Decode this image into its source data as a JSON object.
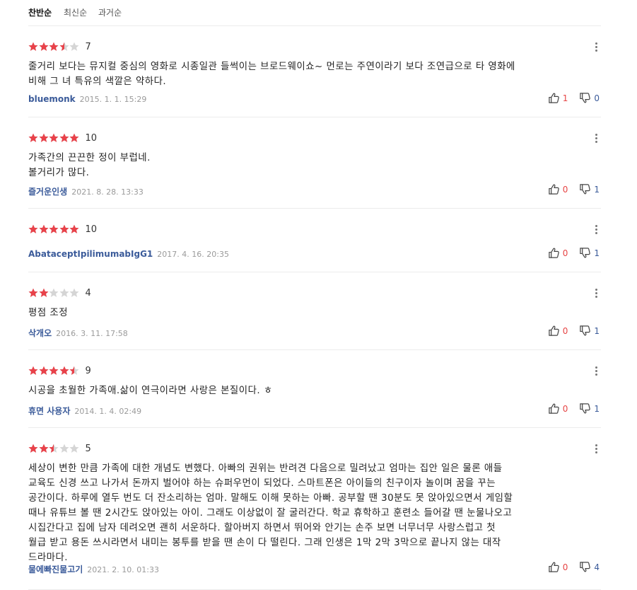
{
  "sort_tabs": [
    "찬반순",
    "최신순",
    "과거순"
  ],
  "active_sort": "찬반순",
  "colors": {
    "star": "#e8424a",
    "star_empty": "#d5d5d5",
    "author": "#3b5b9a",
    "like": "#e64545"
  },
  "reviews": [
    {
      "rating": 7,
      "score": "7",
      "content": "줄거리 보다는 뮤지컬 중심의 영화로 시종일관 들썩이는 브로드웨이쇼~ 먼로는 주연이라기 보다 조연급으로 타 영화에\n비해 그 녀 특유의 색깔은 약하다.",
      "author": "bluemonk",
      "date": "2015. 1. 1. 15:29",
      "likes": "1",
      "dislikes": "0"
    },
    {
      "rating": 10,
      "score": "10",
      "content": "가족간의 끈끈한 정이 부럽네.\n볼거리가 많다.",
      "author": "즐거운인생",
      "date": "2021. 8. 28. 13:33",
      "likes": "0",
      "dislikes": "1"
    },
    {
      "rating": 10,
      "score": "10",
      "content": "",
      "author": "AbataceptIpilimumabIgG1",
      "date": "2017. 4. 16. 20:35",
      "likes": "0",
      "dislikes": "1"
    },
    {
      "rating": 4,
      "score": "4",
      "content": "평점 조정",
      "author": "삭개오",
      "date": "2016. 3. 11. 17:58",
      "likes": "0",
      "dislikes": "1"
    },
    {
      "rating": 9,
      "score": "9",
      "content": "시공을 초월한 가족애.삶이 연극이라면 사랑은 본질이다. ㅎ",
      "author": "휴면 사용자",
      "date": "2014. 1. 4. 02:49",
      "likes": "0",
      "dislikes": "1"
    },
    {
      "rating": 5,
      "score": "5",
      "content": "세상이 변한 만큼 가족에 대한 개념도 변했다. 아빠의 권위는 반려견 다음으로 밀려났고 엄마는 집안 일은 물론 애들\n교육도 신경 쓰고 나가서 돈까지 벌어야 하는 슈퍼우먼이 되었다. 스마트폰은 아이들의 친구이자 놀이며 꿈을 꾸는\n공간이다. 하루에 열두 번도 더 잔소리하는 엄마. 말해도 이해 못하는 아빠. 공부할 땐 30분도 못 앉아있으면서 게임할\n때나 유튜브 볼 땐 2시간도 앉아있는 아이. 그래도 이상없이 잘 굴러간다. 학교 휴학하고 훈련소 들어갈 땐 눈물나오고\n시집간다고 집에 남자 데려오면 괜히 서운하다. 할아버지 하면서 뛰어와 안기는 손주 보면 너무너무 사랑스럽고 첫\n월급 받고 용돈 쓰시라면서 내미는 봉투를 받을 땐 손이 다 떨린다. 그래 인생은 1막 2막 3막으로 끝나지 않는 대작\n드라마다.",
      "author": "물에빠진물고기",
      "date": "2021. 2. 10. 01:33",
      "likes": "0",
      "dislikes": "4"
    }
  ]
}
